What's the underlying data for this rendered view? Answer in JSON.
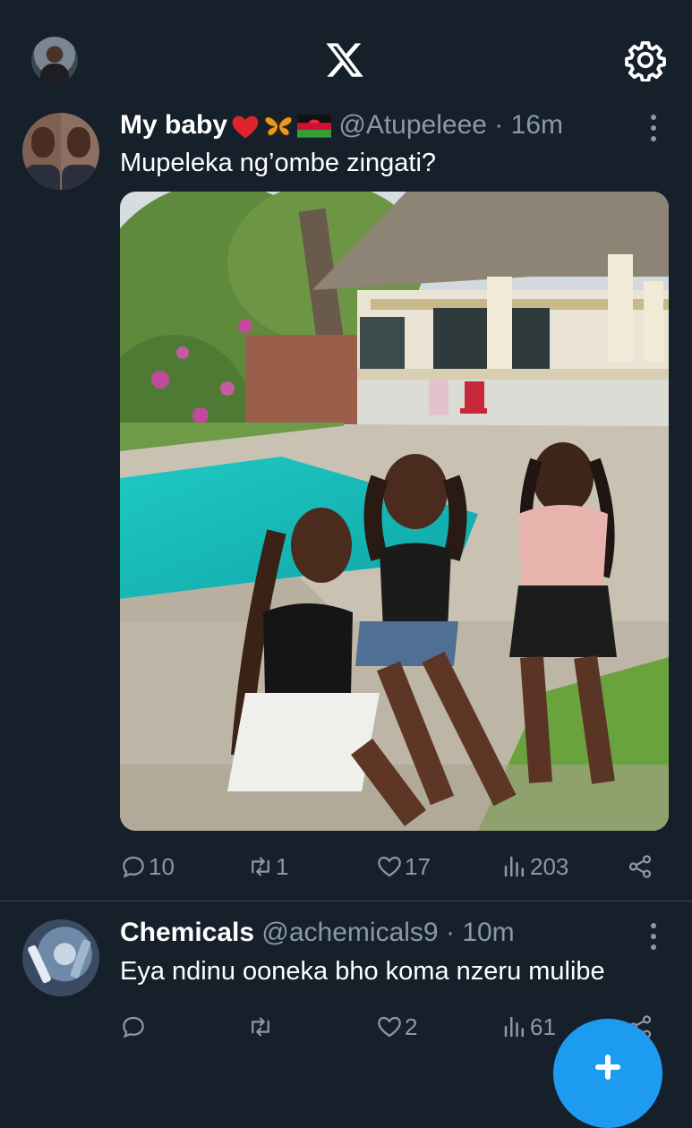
{
  "app": {
    "logo_icon": "x-logo-icon",
    "settings_icon": "gear-icon"
  },
  "tweets": [
    {
      "display_name": "My baby",
      "name_emojis": [
        "red-heart-icon",
        "butterfly-icon",
        "malawi-flag-icon"
      ],
      "handle": "@Atupeleee",
      "separator": "·",
      "time": "16m",
      "text": "Mupeleka ng’ombe zingati?",
      "media": "photo: three women sitting by a swimming pool in front of a thatched-roof house",
      "replies": "10",
      "retweets": "1",
      "likes": "17",
      "views": "203"
    },
    {
      "display_name": "Chemicals",
      "handle": "@achemicals9",
      "separator": "·",
      "time": "10m",
      "text": "Eya ndinu ooneka bho koma nzeru mulibe",
      "replies": "",
      "retweets": "",
      "likes": "2",
      "views": "61"
    }
  ],
  "colors": {
    "background": "#15202b",
    "muted": "#8b98a5",
    "accent": "#1d9bf0",
    "divider": "#38444d"
  }
}
